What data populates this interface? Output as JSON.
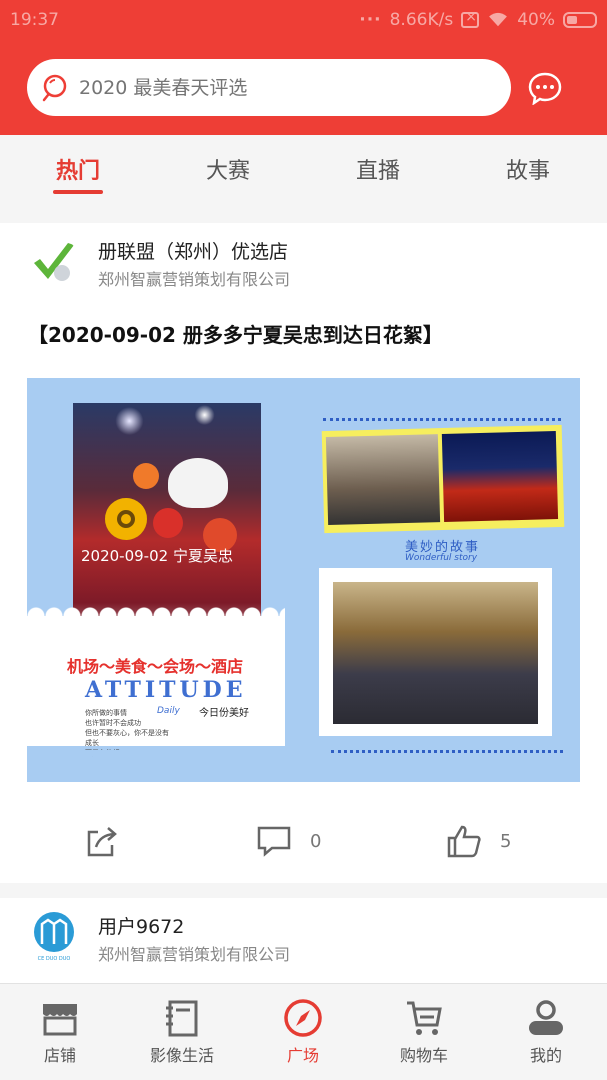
{
  "status_bar": {
    "time": "19:37",
    "network_speed": "8.66K/s",
    "battery": "40%"
  },
  "search": {
    "placeholder": "2020 最美春天评选"
  },
  "tabs": [
    {
      "label": "热门",
      "active": true
    },
    {
      "label": "大赛",
      "active": false
    },
    {
      "label": "直播",
      "active": false
    },
    {
      "label": "故事",
      "active": false
    }
  ],
  "posts": [
    {
      "user": "册联盟（郑州）优选店",
      "company": "郑州智赢营销策划有限公司",
      "title": "【2020-09-02 册多多宁夏吴忠到达日花絮】",
      "image": {
        "photo_caption": "2020-09-02 宁夏吴忠",
        "tagline": "机场～美食～会场～酒店",
        "headline": "ATTITUDE",
        "daily": "Daily",
        "today_text": "今日份美好",
        "small_lines": [
          "你所做的事情",
          "也许暂时不会成功",
          "但也不要灰心，你不是没有成长",
          "而是在扎根"
        ],
        "story_cn": "美妙的故事",
        "story_en": "Wonderful story"
      },
      "comments": "0",
      "likes": "5"
    },
    {
      "user": "用户9672",
      "company": "郑州智赢营销策划有限公司",
      "avatar_text": "CE DUO DUO"
    }
  ],
  "bottom_nav": [
    {
      "label": "店铺",
      "icon": "store-icon",
      "active": false
    },
    {
      "label": "影像生活",
      "icon": "notebook-icon",
      "active": false
    },
    {
      "label": "广场",
      "icon": "compass-icon",
      "active": true
    },
    {
      "label": "购物车",
      "icon": "cart-icon",
      "active": false
    },
    {
      "label": "我的",
      "icon": "user-icon",
      "active": false
    }
  ],
  "colors": {
    "brand_red": "#ee3e36",
    "active_red": "#e53c33",
    "text_gray": "#888888"
  }
}
